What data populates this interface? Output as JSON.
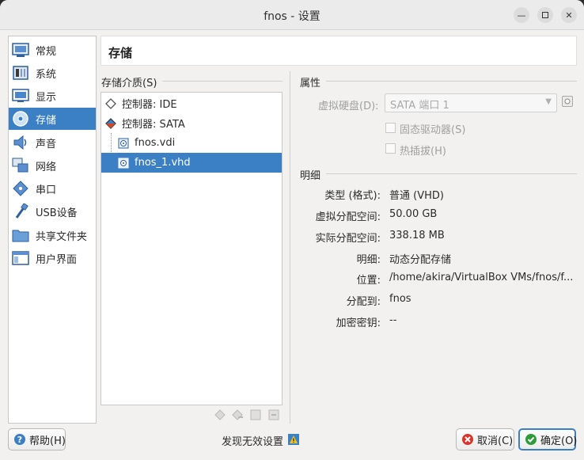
{
  "window": {
    "title": "fnos - 设置"
  },
  "sidebar": {
    "items": [
      {
        "label": "常规",
        "icon": "general-icon"
      },
      {
        "label": "系统",
        "icon": "system-icon"
      },
      {
        "label": "显示",
        "icon": "display-icon"
      },
      {
        "label": "存储",
        "icon": "storage-icon",
        "active": true
      },
      {
        "label": "声音",
        "icon": "audio-icon"
      },
      {
        "label": "网络",
        "icon": "network-icon"
      },
      {
        "label": "串口",
        "icon": "serial-port-icon"
      },
      {
        "label": "USB设备",
        "icon": "usb-icon"
      },
      {
        "label": "共享文件夹",
        "icon": "shared-folder-icon"
      },
      {
        "label": "用户界面",
        "icon": "user-interface-icon"
      }
    ]
  },
  "header": {
    "title": "存储"
  },
  "storage": {
    "section_label": "存储介质(S)",
    "tree": [
      {
        "label": "控制器: IDE",
        "type": "controller"
      },
      {
        "label": "控制器: SATA",
        "type": "controller"
      },
      {
        "label": "fnos.vdi",
        "type": "disk"
      },
      {
        "label": "fnos_1.vhd",
        "type": "disk",
        "selected": true
      }
    ]
  },
  "attributes": {
    "section_label": "属性",
    "hard_disk_label": "虚拟硬盘(D):",
    "hard_disk_value": "SATA 端口 1",
    "ssd_label": "固态驱动器(S)",
    "hotplug_label": "热插拔(H)"
  },
  "info": {
    "section_label": "明细",
    "rows": [
      {
        "key": "类型 (格式):",
        "value": "普通 (VHD)"
      },
      {
        "key": "虚拟分配空间:",
        "value": "50.00 GB"
      },
      {
        "key": "实际分配空间:",
        "value": "338.18 MB"
      },
      {
        "key": "明细:",
        "value": "动态分配存储"
      },
      {
        "key": "位置:",
        "value": "/home/akira/VirtualBox VMs/fnos/f..."
      },
      {
        "key": "分配到:",
        "value": "fnos"
      },
      {
        "key": "加密密钥:",
        "value": "--"
      }
    ]
  },
  "footer": {
    "help_label": "帮助(H)",
    "warning_text": "发现无效设置",
    "cancel_label": "取消(C)",
    "ok_label": "确定(O)"
  },
  "colors": {
    "accent": "#3b7fc4",
    "ok_green": "#2e9a3a",
    "cancel_red": "#d9362b"
  }
}
